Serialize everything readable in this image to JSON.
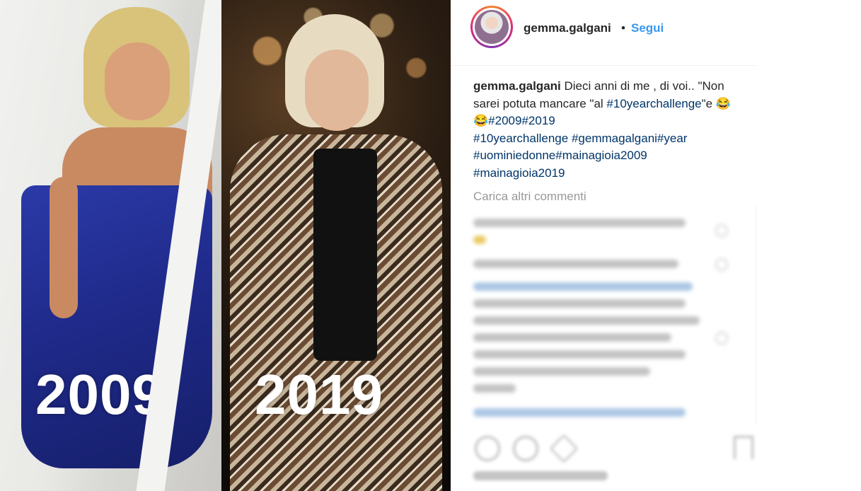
{
  "photos": {
    "left_year": "2009",
    "right_year": "2019"
  },
  "header": {
    "username": "gemma.galgani",
    "separator": "•",
    "follow_label": "Segui"
  },
  "caption": {
    "username": "gemma.galgani",
    "text": "Dieci anni di me , di voi.. \"Non sarei potuta mancare \"al ",
    "tag1": "#10yearchallenge",
    "mid": "\"e 😂😂",
    "tag2": "#2009",
    "tag3": "#2019",
    "tag4": "#10yearchallenge",
    "tag5": "#gemmagalgani",
    "tag6": "#year",
    "tag7": "#uominiedonne",
    "tag8": "#mainagioia2009",
    "tag9": "#mainagioia2019"
  },
  "comments": {
    "load_more_label": "Carica altri commenti"
  },
  "colors": {
    "accent": "#3897f0",
    "hashtag": "#003569",
    "muted": "#999999"
  }
}
